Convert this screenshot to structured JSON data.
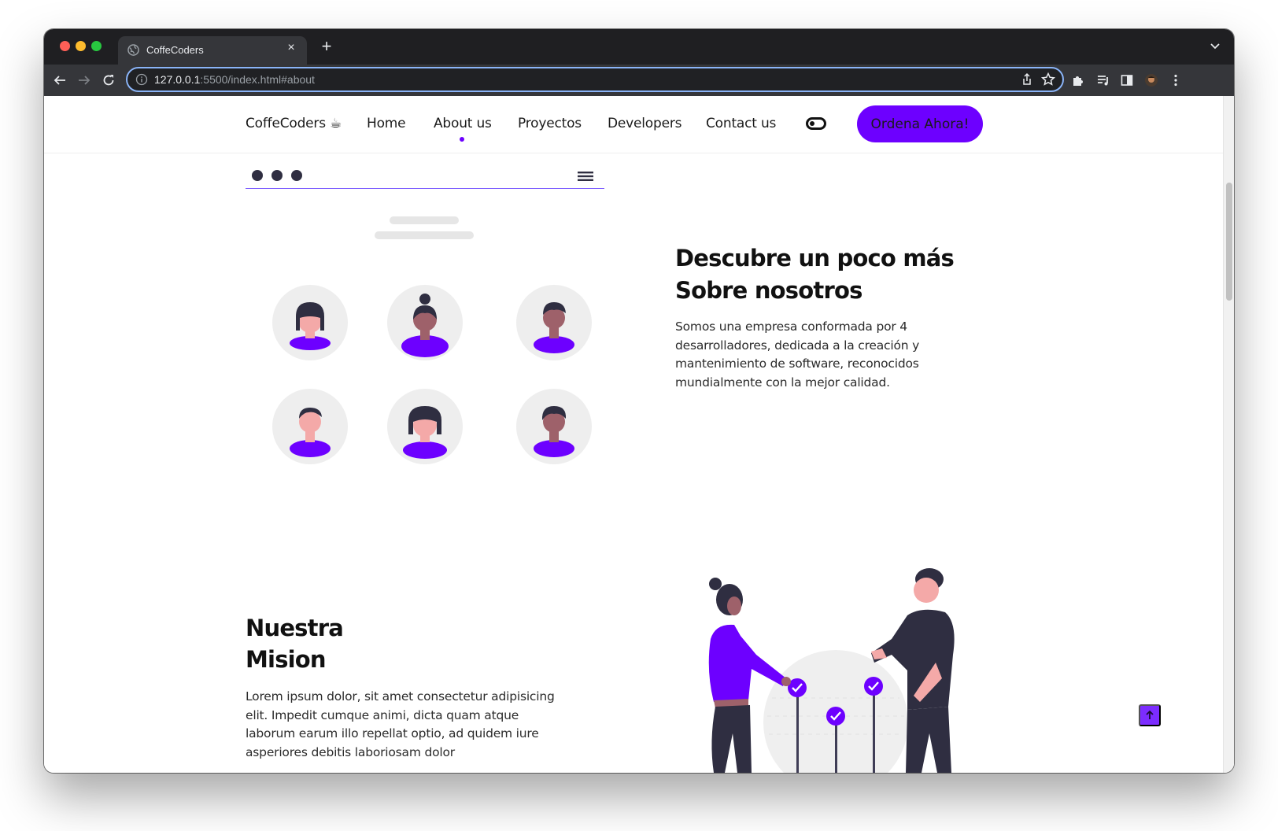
{
  "browser": {
    "tab_title": "CoffeCoders",
    "new_tab_symbol": "+",
    "tab_close_symbol": "×",
    "url_host": "127.0.0.1",
    "url_rest": ":5500/index.html#about"
  },
  "site": {
    "brand": "CoffeCoders ☕",
    "nav": [
      {
        "label": "Home"
      },
      {
        "label": "About us"
      },
      {
        "label": "Proyectos"
      },
      {
        "label": "Developers"
      },
      {
        "label": "Contact us"
      }
    ],
    "active_nav": "About us",
    "cta_label": "Ordena Ahora!",
    "accent_color": "#6d00ff"
  },
  "about": {
    "title_line1": "Descubre un poco más",
    "title_line2": "Sobre nosotros",
    "body": "Somos una empresa conformada por 4 desarrolladores, dedicada a la creación y mantenimiento de software, reconocidos mundialmente con la mejor calidad."
  },
  "mission": {
    "title_line1": "Nuestra",
    "title_line2": "Mision",
    "body": "Lorem ipsum dolor, sit amet consectetur adipisicing elit. Impedit cumque animi, dicta quam atque laborum earum illo repellat optio, ad quidem iure asperiores debitis laboriosam dolor"
  },
  "icons": {
    "back_to_top": "arrow-up-icon",
    "theme": "toggle-icon"
  }
}
